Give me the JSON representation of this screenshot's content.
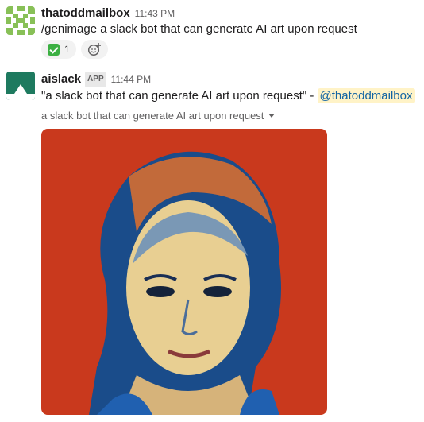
{
  "messages": [
    {
      "user": "thatoddmailbox",
      "time": "11:43 PM",
      "text": "/genimage a slack bot that can generate AI art upon request",
      "reactions": [
        {
          "icon": "white-check-mark-icon",
          "count": "1"
        }
      ],
      "add_reaction_icon": "add-reaction-icon"
    },
    {
      "user": "aislack",
      "badge": "APP",
      "time": "11:44 PM",
      "text": "\"a slack bot that can generate AI art upon request\" - ",
      "mention": "@thatoddmailbox",
      "attachment": {
        "caption": "a slack bot that can generate AI art upon request",
        "image_alt": "AI-generated portrait of a woman"
      }
    }
  ],
  "colors": {
    "link": "#1264a3",
    "mention_bg": "#fff3c7",
    "reaction_bg": "#f2f2f2",
    "avatar1": "#88c057",
    "avatar2": "#1e7a5f",
    "art_bg": "#c9391d",
    "art_hair": "#1a4c8a"
  }
}
